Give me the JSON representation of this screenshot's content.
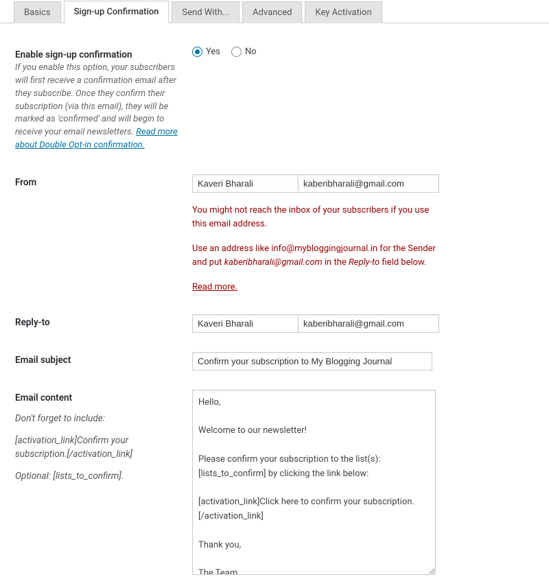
{
  "tabs": [
    {
      "label": "Basics",
      "active": false
    },
    {
      "label": "Sign-up Confirmation",
      "active": true
    },
    {
      "label": "Send With...",
      "active": false
    },
    {
      "label": "Advanced",
      "active": false
    },
    {
      "label": "Key Activation",
      "active": false
    }
  ],
  "enable": {
    "label": "Enable sign-up confirmation",
    "desc": "If you enable this option, your subscribers will first receive a confirmation email after they subscribe. Once they confirm their subscription (via this email), they will be marked as 'confirmed' and will begin to receive your email newsletters. ",
    "link_text": "Read more about Double Opt-in confirmation.",
    "yes": "Yes",
    "no": "No",
    "value": "yes"
  },
  "from": {
    "label": "From",
    "name": "Kaveri Bharali",
    "email": "kaberibharali@gmail.com",
    "warn1": "You might not reach the inbox of your subscribers if you use this email address.",
    "warn2a": "Use an address like info@mybloggingjournal.in for the Sender and put ",
    "warn2_em": "kaberibharali@gmail.com",
    "warn2b": " in the ",
    "warn2_em2": "Reply-to",
    "warn2c": " field below.",
    "read_more": "Read more."
  },
  "reply": {
    "label": "Reply-to",
    "name": "Kaveri Bharali",
    "email": "kaberibharali@gmail.com"
  },
  "subject": {
    "label": "Email subject",
    "value": "Confirm your subscription to My Blogging Journal"
  },
  "content": {
    "label": "Email content",
    "helper1": "Don't forget to include:",
    "helper2": "[activation_link]Confirm your subscription.[/activation_link]",
    "helper3": "Optional: [lists_to_confirm].",
    "value": "Hello,\n\nWelcome to our newsletter!\n\nPlease confirm your subscription to the list(s): [lists_to_confirm] by clicking the link below:\n\n[activation_link]Click here to confirm your subscription.[/activation_link]\n\nThank you,\n\nThe Team"
  }
}
